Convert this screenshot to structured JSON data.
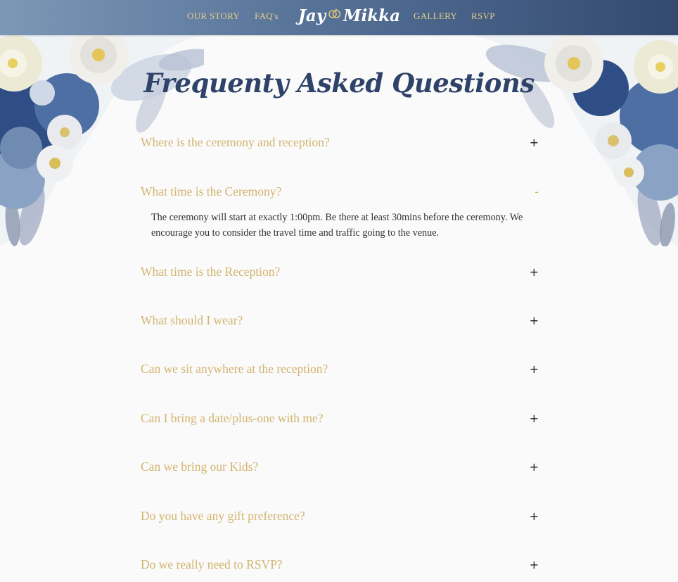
{
  "nav": {
    "left": [
      "OUR STORY",
      "FAQ's"
    ],
    "brand_first": "Jay",
    "brand_second": "Mikka",
    "right": [
      "GALLERY",
      "RSVP"
    ]
  },
  "colors": {
    "accent_gold": "#d3b46f",
    "title_navy": "#2f4369",
    "nav_gradient_start": "#7d97b6",
    "nav_gradient_end": "#34496e"
  },
  "page_title": "Frequenty Asked Questions",
  "faq": {
    "items": [
      {
        "question": "Where is the ceremony and reception?",
        "toggle": "+",
        "expanded": false
      },
      {
        "question": "What time is the Ceremony?",
        "toggle": "-",
        "expanded": true,
        "answer": "The ceremony will start at exactly 1:00pm. Be there at least 30mins before the ceremony. We encourage you to consider the travel time and traffic going to the venue."
      },
      {
        "question": "What time is the Reception?",
        "toggle": "+",
        "expanded": false
      },
      {
        "question": "What should I wear?",
        "toggle": "+",
        "expanded": false
      },
      {
        "question": "Can we sit anywhere at the reception?",
        "toggle": "+",
        "expanded": false
      },
      {
        "question": "Can I bring a date/plus-one with me?",
        "toggle": "+",
        "expanded": false
      },
      {
        "question": "Can we bring our Kids?",
        "toggle": "+",
        "expanded": false
      },
      {
        "question": "Do you have any gift preference?",
        "toggle": "+",
        "expanded": false
      },
      {
        "question": "Do we really need to RSVP?",
        "toggle": "+",
        "expanded": false
      }
    ]
  },
  "icons": [
    "wedding-rings-icon",
    "plus-icon",
    "minus-icon",
    "floral-corner-left",
    "floral-corner-right"
  ]
}
